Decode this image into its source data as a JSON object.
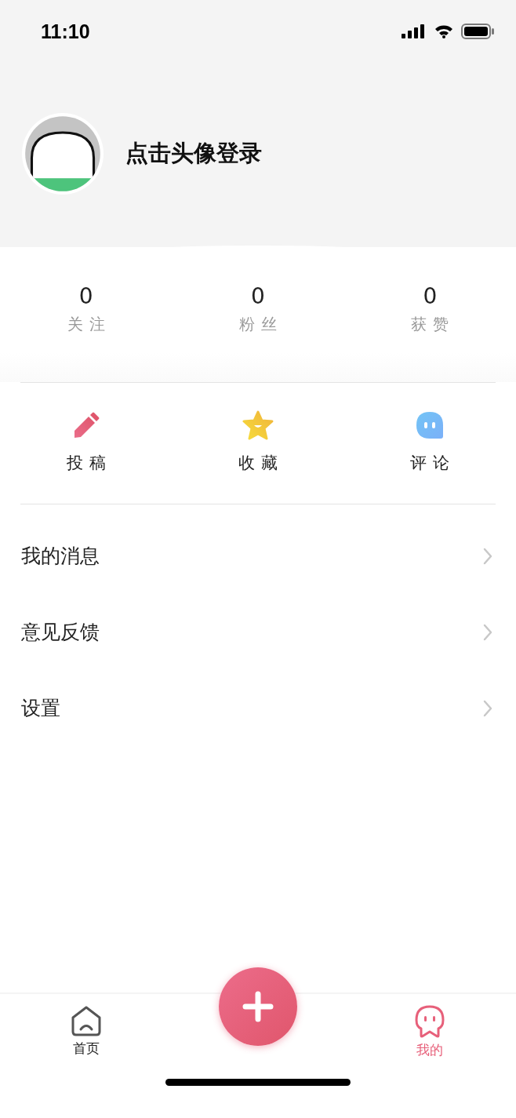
{
  "status_bar": {
    "time": "11:10"
  },
  "profile": {
    "login_prompt": "点击头像登录"
  },
  "stats": [
    {
      "value": "0",
      "label": "关注"
    },
    {
      "value": "0",
      "label": "粉丝"
    },
    {
      "value": "0",
      "label": "获赞"
    }
  ],
  "actions": [
    {
      "kind": "pencil",
      "label": "投稿"
    },
    {
      "kind": "star",
      "label": "收藏"
    },
    {
      "kind": "bubble",
      "label": "评论"
    }
  ],
  "menu": [
    {
      "label": "我的消息"
    },
    {
      "label": "意见反馈"
    },
    {
      "label": "设置"
    }
  ],
  "tab_bar": [
    {
      "kind": "home",
      "label": "首页",
      "selected": false
    },
    {
      "kind": "add",
      "selected": false
    },
    {
      "kind": "mine",
      "label": "我的",
      "selected": true
    }
  ]
}
